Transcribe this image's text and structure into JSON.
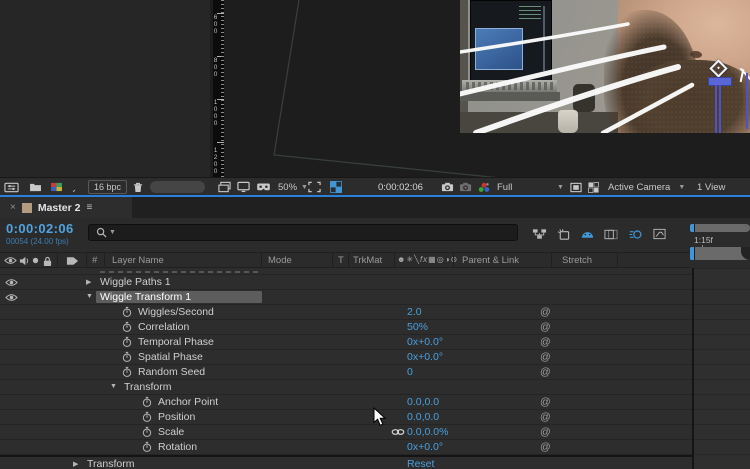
{
  "colors": {
    "accent_blue": "#3f96d8",
    "value_blue": "#4b9fdd",
    "divider_blue": "#2a7fd6",
    "tab_swatch": "#b39b7f"
  },
  "viewer": {
    "ruler_values": [
      "600",
      "800",
      "1000",
      "1200"
    ],
    "toolbar": {
      "zoom_value": "50%",
      "timecode": "0:00:02:06",
      "resolution": "Full",
      "camera": "Active Camera",
      "views": "1 View",
      "icons": [
        "always-preview-icon",
        "primary-monitor-icon",
        "vr-icon",
        "region-of-interest-icon",
        "transparency-grid-icon",
        "snapshot-icon",
        "show-snapshot-icon",
        "channels-icon",
        "target-region-icon",
        "pixel-aspect-icon"
      ]
    }
  },
  "project_panel": {
    "bit_depth": "16 bpc",
    "icons": [
      "interpret-footage-icon",
      "folder-icon",
      "new-composition-icon",
      "brush-icon",
      "trash-icon"
    ]
  },
  "timeline": {
    "tab_title": "Master 2",
    "close_glyph": "×",
    "menu_glyph": "≡",
    "timecode": "0:00:02:06",
    "frame_info": "00054 (24.00 fps)",
    "ruler_label": "1:15f",
    "toolbar_icons": [
      {
        "name": "mini-flowchart-icon",
        "active": false
      },
      {
        "name": "draft-3d-icon",
        "active": false
      },
      {
        "name": "shy-icon",
        "active": true
      },
      {
        "name": "frame-blending-icon",
        "active": false
      },
      {
        "name": "motion-blur-icon",
        "active": true
      },
      {
        "name": "graph-editor-icon",
        "active": false
      }
    ],
    "columns": {
      "number": "#",
      "layer_name": "Layer Name",
      "mode": "Mode",
      "t": "T",
      "trkmat": "TrkMat",
      "parent": "Parent & Link",
      "stretch": "Stretch"
    },
    "switch_column_icons": [
      "shy",
      "collapse",
      "quality",
      "fx",
      "frame-blend",
      "motion-blur",
      "adjustment-layer",
      "3d-layer"
    ],
    "rows": [
      {
        "pos": "g1",
        "arrow": "right",
        "eye": true,
        "label": "Wiggle Paths 1"
      },
      {
        "pos": "g1",
        "arrow": "down",
        "eye": true,
        "label": "Wiggle Transform 1",
        "selected": true
      },
      {
        "pos": "p2",
        "stopwatch": true,
        "label": "Wiggles/Second",
        "value": "2.0",
        "whip": true
      },
      {
        "pos": "p2",
        "stopwatch": true,
        "label": "Correlation",
        "value": "50%",
        "whip": true
      },
      {
        "pos": "p2",
        "stopwatch": true,
        "label": "Temporal Phase",
        "value": "0x+0.0°",
        "whip": true
      },
      {
        "pos": "p2",
        "stopwatch": true,
        "label": "Spatial Phase",
        "value": "0x+0.0°",
        "whip": true
      },
      {
        "pos": "p2",
        "stopwatch": true,
        "label": "Random Seed",
        "value": "0",
        "whip": true
      },
      {
        "pos": "g2",
        "arrow": "down",
        "label": "Transform"
      },
      {
        "pos": "p3",
        "stopwatch": true,
        "label": "Anchor Point",
        "value": "0.0,0.0",
        "whip": true
      },
      {
        "pos": "p3",
        "stopwatch": true,
        "label": "Position",
        "value": "0.0,0.0",
        "whip": true
      },
      {
        "pos": "p3",
        "stopwatch": true,
        "label": "Scale",
        "value": "0.0,0.0%",
        "link": true,
        "whip": true
      },
      {
        "pos": "p3",
        "stopwatch": true,
        "label": "Rotation",
        "value": "0x+0.0°",
        "whip": true
      },
      {
        "pos": "g0",
        "arrow": "right",
        "label": "Transform",
        "value": "Reset",
        "divider": true
      }
    ]
  }
}
